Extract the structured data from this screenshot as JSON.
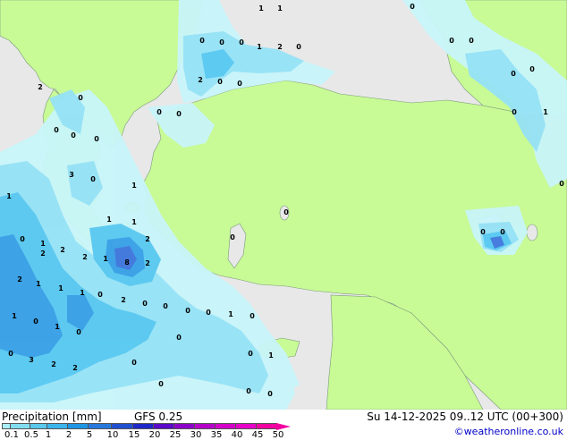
{
  "footer": {
    "title": "Precipitation [mm]",
    "model": "GFS 0.25",
    "datetime": "Su 14-12-2025 09..12 UTC (00+300)",
    "credit": "©weatheronline.co.uk"
  },
  "legend": {
    "ticks": [
      "0.1",
      "0.5",
      "1",
      "2",
      "5",
      "10",
      "15",
      "20",
      "25",
      "30",
      "35",
      "40",
      "45",
      "50"
    ],
    "colors": [
      "#aaf0fa",
      "#82dcf0",
      "#5ac8ec",
      "#3cb4ec",
      "#1e96e6",
      "#2878dc",
      "#2050d0",
      "#1e28c8",
      "#5a0ac8",
      "#8c00c8",
      "#b400c8",
      "#d200c8",
      "#e600c8",
      "#f000a0"
    ]
  },
  "map_colors": {
    "sea": "#e8e8e8",
    "land": "#c8fa96",
    "precip_light": "#c8f5fa",
    "precip_medium": "#96e1f5",
    "precip_heavy": "#5ac8f0",
    "precip_intense": "#3ca0e6",
    "precip_peak": "#4678dc"
  },
  "point_values": [
    "1",
    "1",
    "0",
    "0",
    "0",
    "1",
    "2",
    "0",
    "2",
    "0",
    "0",
    "0",
    "0",
    "0",
    "0",
    "0",
    "0",
    "0",
    "0",
    "1",
    "0",
    "2",
    "0",
    "0",
    "0",
    "0",
    "1",
    "0",
    "3",
    "1",
    "0",
    "1",
    "2",
    "2",
    "1",
    "8",
    "2",
    "2",
    "1",
    "1",
    "1",
    "0",
    "2",
    "0",
    "1",
    "1",
    "2",
    "1",
    "0",
    "1",
    "0",
    "2",
    "0",
    "3",
    "2",
    "2",
    "0",
    "0",
    "0",
    "1",
    "0",
    "0",
    "1",
    "0",
    "0",
    "0",
    "0",
    "0",
    "0",
    "0",
    "0",
    "0"
  ]
}
